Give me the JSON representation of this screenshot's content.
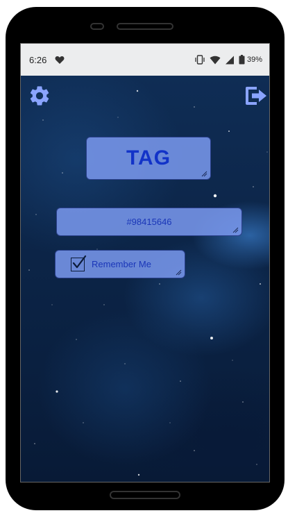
{
  "statusbar": {
    "time": "6:26",
    "battery_percent": "39%",
    "icons": [
      "heart-icon",
      "vibrate-icon",
      "wifi-icon",
      "signal-icon",
      "battery-icon"
    ]
  },
  "toolbar": {
    "settings_icon": "gear-icon",
    "logout_icon": "logout-icon"
  },
  "main": {
    "title": "TAG",
    "id_value": "#98415646",
    "remember_label": "Remember Me",
    "remember_checked": true
  },
  "colors": {
    "accent": "#7896eb",
    "text_blue": "#1233c8",
    "icon_blue": "#8aa4ff"
  }
}
